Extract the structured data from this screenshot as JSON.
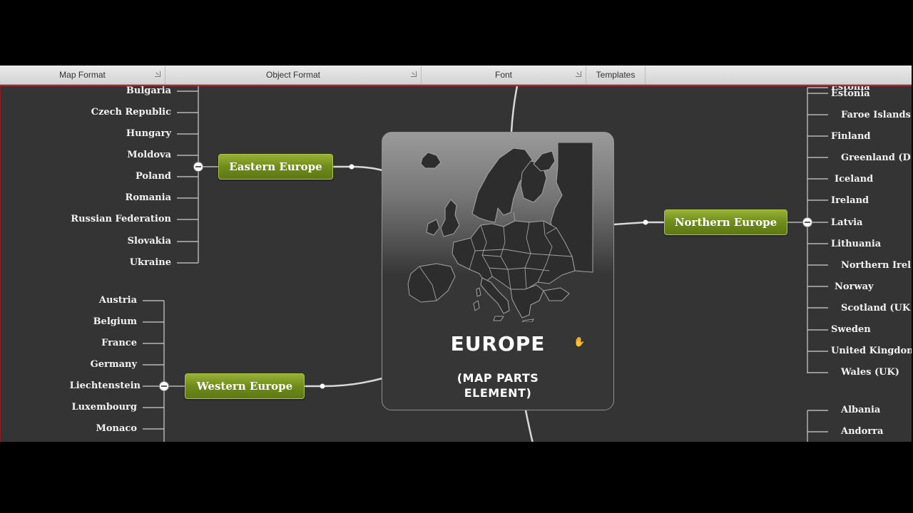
{
  "ribbon": {
    "groups": [
      {
        "label": "Map Format",
        "launcher": true
      },
      {
        "label": "Object Format",
        "launcher": true
      },
      {
        "label": "Font",
        "launcher": true
      },
      {
        "label": "Templates",
        "launcher": false
      }
    ]
  },
  "central": {
    "title": "EUROPE",
    "subtitle_line1": "(MAP PARTS",
    "subtitle_line2": "ELEMENT)"
  },
  "branches": {
    "eastern": {
      "label": "Eastern Europe",
      "items": [
        "Bulgaria",
        "Czech Republic",
        "Hungary",
        "Moldova",
        "Poland",
        "Romania",
        "Russian Federation",
        "Slovakia",
        "Ukraine"
      ]
    },
    "western": {
      "label": "Western Europe",
      "items": [
        "Austria",
        "Belgium",
        "France",
        "Germany",
        "Liechtenstein",
        "Luxembourg",
        "Monaco"
      ]
    },
    "northern": {
      "label": "Northern Europe",
      "items": [
        "Estonia",
        "Estonia",
        "Faroe Islands",
        "Finland",
        "Greenland (D",
        "Iceland",
        "Ireland",
        "Latvia",
        "Lithuania",
        "Northern Irel",
        "Norway",
        "Scotland (UK",
        "Sweden",
        "United Kingdon",
        "Wales (UK)"
      ]
    },
    "southern": {
      "items": [
        "Albania",
        "Andorra"
      ]
    }
  },
  "colors": {
    "canvas": "#343434",
    "topic_green": "#6f8c1c",
    "accent_red": "#b1242a",
    "connector": "#cfcfcf"
  },
  "icons": {
    "collapse": "minus-circle-icon",
    "cursor": "hand-cursor-icon"
  }
}
